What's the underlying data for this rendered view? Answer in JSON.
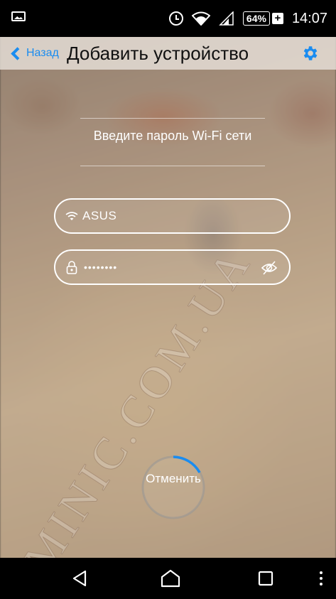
{
  "status_bar": {
    "battery_percent": "64%",
    "battery_charging_symbol": "+",
    "time": "14:07",
    "icons": [
      "gallery-icon",
      "alarm-icon",
      "wifi-icon",
      "signal-icon",
      "battery-icon"
    ]
  },
  "header": {
    "back_label": "Назад",
    "title": "Добавить устройство",
    "settings_icon": "gear-icon"
  },
  "prompt": {
    "text": "Введите пароль Wi-Fi сети"
  },
  "ssid_field": {
    "icon": "wifi-icon",
    "value": "ASUS"
  },
  "password_field": {
    "icon": "lock-icon",
    "masked_value": "••••••••",
    "toggle_icon": "eye-off-icon"
  },
  "cancel": {
    "label": "Отменить",
    "icon": "loading-spinner"
  },
  "watermark": {
    "text": "MINIC.COM.UA"
  },
  "nav_bar": {
    "icons": [
      "back-triangle-icon",
      "home-icon",
      "recent-apps-icon",
      "more-icon"
    ]
  },
  "colors": {
    "accent": "#1a8cf0",
    "status_bar_bg": "#000000",
    "nav_bar_bg": "#000000",
    "header_bg": "#ebe4de"
  }
}
